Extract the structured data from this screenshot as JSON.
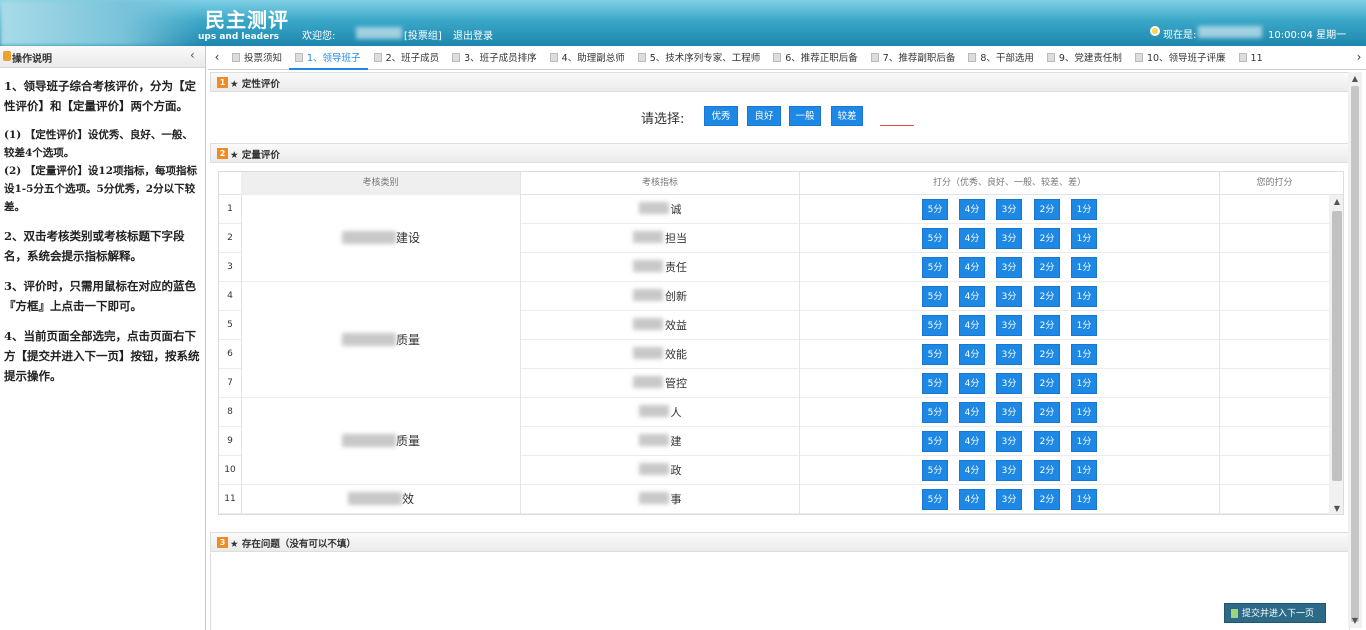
{
  "header": {
    "title": "民主测评",
    "subtitle": "ups and leaders",
    "welcome": "欢迎您:",
    "group": "[投票组]",
    "logout": "退出登录",
    "now_label": "现在是:",
    "time": "10:00:04 星期一"
  },
  "left_panel": {
    "title": "操作说明",
    "collapse": "‹",
    "p1": "1、领导班子综合考核评价，分为【定性评价】和【定量评价】两个方面。",
    "p2": "(1) 【定性评价】设优秀、良好、一般、较差4个选项。",
    "p3": "(2) 【定量评价】设12项指标，每项指标设1-5分五个选项。5分优秀，2分以下较差。",
    "p4": "2、双击考核类别或考核标题下字段名，系统会提示指标解释。",
    "p5": "3、评价时，只需用鼠标在对应的蓝色『方框』上点击一下即可。",
    "p6": "4、当前页面全部选完，点击页面右下方【提交并进入下一页】按钮，按系统提示操作。"
  },
  "tabs": {
    "prev": "‹",
    "next": "›",
    "items": [
      "投票须知",
      "1、领导班子",
      "2、班子成员",
      "3、班子成员排序",
      "4、助理副总师",
      "5、技术序列专家、工程师",
      "6、推荐正职后备",
      "7、推荐副职后备",
      "8、干部选用",
      "9、党建责任制",
      "10、领导班子评廉",
      "11"
    ],
    "active_index": 1
  },
  "section1": {
    "num": "1",
    "title": "★ 定性评价",
    "choose_label": "请选择:",
    "options": [
      "优秀",
      "良好",
      "一般",
      "较差"
    ]
  },
  "section2": {
    "num": "2",
    "title": "★ 定量评价",
    "headers": {
      "category": "考核类别",
      "indicator": "考核指标",
      "score": "打分（优秀、良好、一般、较差、差）",
      "mine": "您的打分"
    },
    "score_options": [
      "5分",
      "4分",
      "3分",
      "2分",
      "1分"
    ],
    "categories": [
      {
        "label": "建设"
      },
      {
        "label": "质量"
      },
      {
        "label": "质量"
      },
      {
        "label": "效"
      }
    ],
    "rows": [
      {
        "index": "1",
        "indicator": "诚"
      },
      {
        "index": "2",
        "indicator": "担当"
      },
      {
        "index": "3",
        "indicator": "责任"
      },
      {
        "index": "4",
        "indicator": "创新"
      },
      {
        "index": "5",
        "indicator": "效益"
      },
      {
        "index": "6",
        "indicator": "效能"
      },
      {
        "index": "7",
        "indicator": "管控"
      },
      {
        "index": "8",
        "indicator": "人"
      },
      {
        "index": "9",
        "indicator": "建"
      },
      {
        "index": "10",
        "indicator": "政"
      },
      {
        "index": "11",
        "indicator": "事"
      }
    ]
  },
  "section3": {
    "num": "3",
    "title": "★ 存在问题（没有可以不填）"
  },
  "submit": "提交并进入下一页",
  "colors": {
    "accent": "#1e88e5",
    "header": "#3aa7c8",
    "section_badge": "#f08a24",
    "submit": "#2d6a87"
  }
}
